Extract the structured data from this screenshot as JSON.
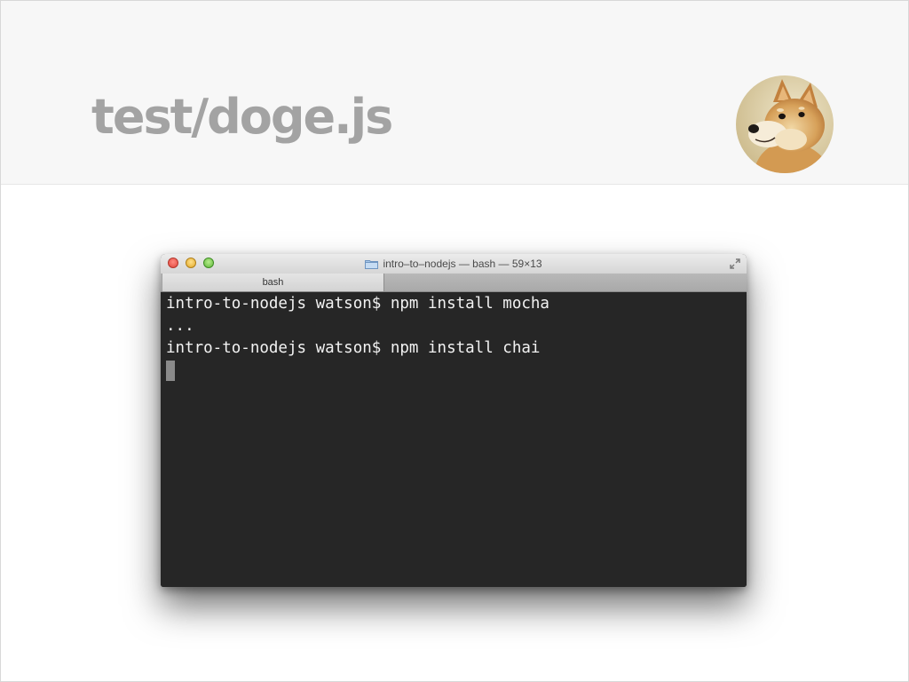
{
  "slide": {
    "title": "test/doge.js"
  },
  "avatar": {
    "description": "doge"
  },
  "terminal": {
    "window_title": "intro–to–nodejs — bash — 59×13",
    "tab_label": "bash",
    "lines": [
      "intro-to-nodejs watson$ npm install mocha",
      "...",
      "intro-to-nodejs watson$ npm install chai"
    ]
  },
  "colors": {
    "terminal_background": "#262626",
    "terminal_text": "#f2f2f2",
    "title_text": "#a3a3a3",
    "header_background": "#f7f7f7"
  }
}
